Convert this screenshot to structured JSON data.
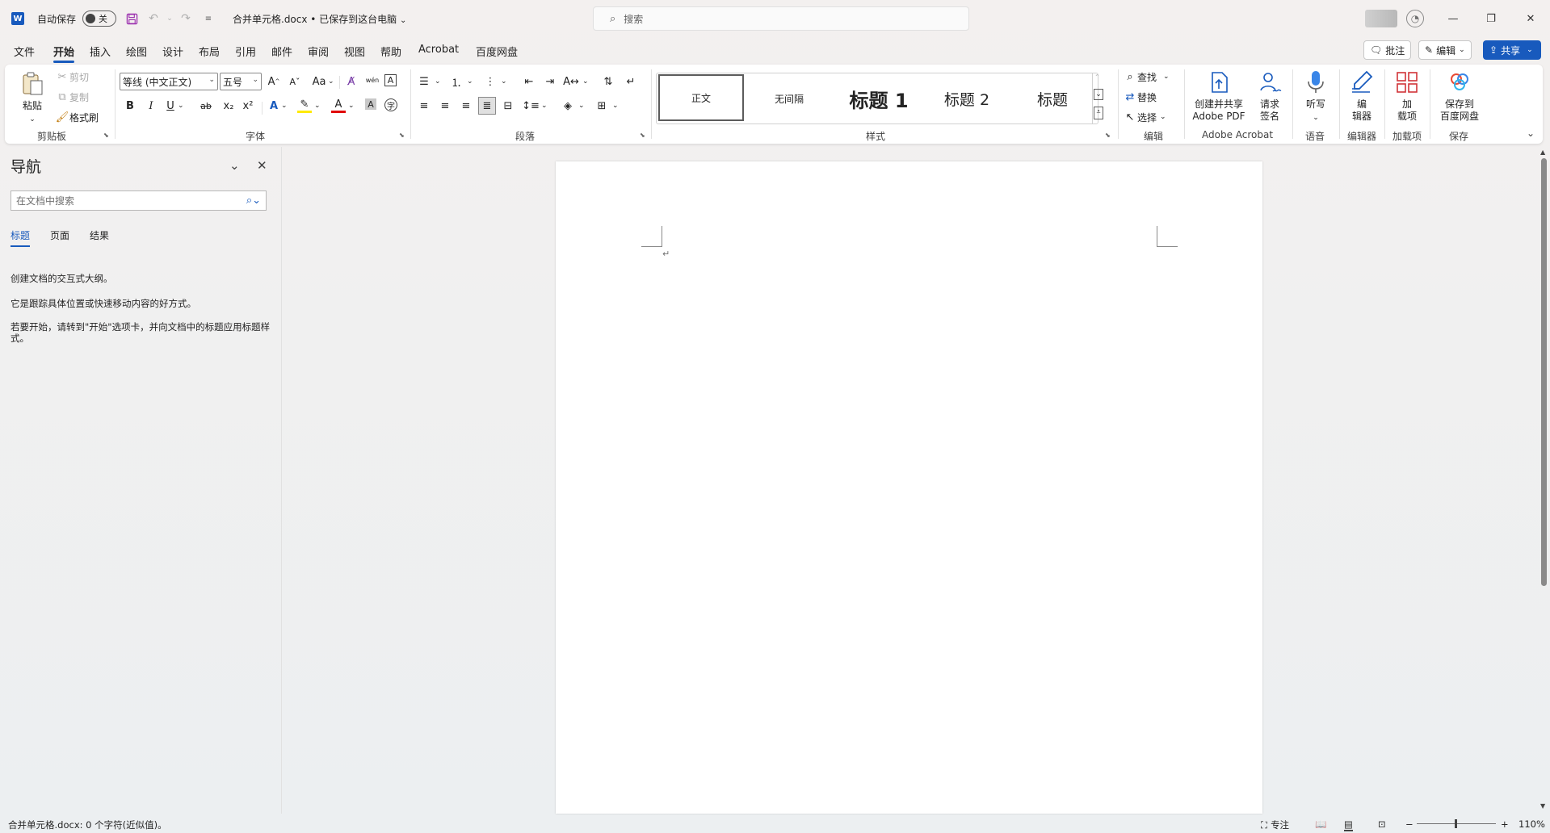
{
  "titlebar": {
    "app_logo": "W",
    "autosave_label": "自动保存",
    "autosave_state": "关",
    "doc_title": "合并单元格.docx • 已保存到这台电脑",
    "search_placeholder": "搜索",
    "icons": [
      "save-icon",
      "undo-icon",
      "redo-icon",
      "customize-icon",
      "user-icon"
    ]
  },
  "tabs": [
    {
      "label": "文件"
    },
    {
      "label": "开始"
    },
    {
      "label": "插入"
    },
    {
      "label": "绘图"
    },
    {
      "label": "设计"
    },
    {
      "label": "布局"
    },
    {
      "label": "引用"
    },
    {
      "label": "邮件"
    },
    {
      "label": "审阅"
    },
    {
      "label": "视图"
    },
    {
      "label": "帮助"
    },
    {
      "label": "Acrobat"
    },
    {
      "label": "百度网盘"
    }
  ],
  "topright": {
    "comments": "批注",
    "editing": "编辑",
    "share": "共享"
  },
  "ribbon": {
    "clipboard": {
      "paste": "粘贴",
      "cut": "剪切",
      "copy": "复制",
      "format_painter": "格式刷",
      "label": "剪贴板"
    },
    "font": {
      "font_name": "等线 (中文正文)",
      "font_size": "五号",
      "label": "字体",
      "bold": "B",
      "italic": "I",
      "underline": "U",
      "strike": "ab",
      "sub": "x₂",
      "sup": "x²",
      "grow": "A^",
      "shrink": "Aˇ",
      "case": "Aa",
      "phonetic": "wén",
      "border_char": "A"
    },
    "paragraph": {
      "label": "段落"
    },
    "styles": {
      "label": "样式",
      "items": [
        "正文",
        "无间隔",
        "标题 1",
        "标题 2",
        "标题"
      ]
    },
    "editing": {
      "find": "查找",
      "replace": "替换",
      "select": "选择",
      "label": "编辑"
    },
    "acrobat": {
      "create_share": "创建并共享",
      "adobe_pdf": "Adobe PDF",
      "request": "请求",
      "sign": "签名",
      "label": "Adobe Acrobat"
    },
    "voice": {
      "dictate": "听写",
      "label": "语音"
    },
    "editor": {
      "line1": "编",
      "line2": "辑器",
      "label": "编辑器"
    },
    "addins": {
      "line1": "加",
      "line2": "载项",
      "label": "加载项"
    },
    "save": {
      "line1": "保存到",
      "line2": "百度网盘",
      "label": "保存"
    }
  },
  "nav": {
    "title": "导航",
    "search_placeholder": "在文档中搜索",
    "tabs": [
      "标题",
      "页面",
      "结果"
    ],
    "text1": "创建文档的交互式大纲。",
    "text2": "它是跟踪具体位置或快速移动内容的好方式。",
    "text3": "若要开始，请转到\"开始\"选项卡，并向文档中的标题应用标题样式。"
  },
  "document": {
    "paragraph_mark": "↵"
  },
  "status": {
    "word_count": "合并单元格.docx: 0 个字符(近似值)。",
    "focus": "专注",
    "zoom_minus": "−",
    "zoom_plus": "+",
    "zoom_level": "110%"
  },
  "colors": {
    "accent": "#185abd",
    "save_icon": "#a4262c",
    "style_heading": "#000000"
  }
}
